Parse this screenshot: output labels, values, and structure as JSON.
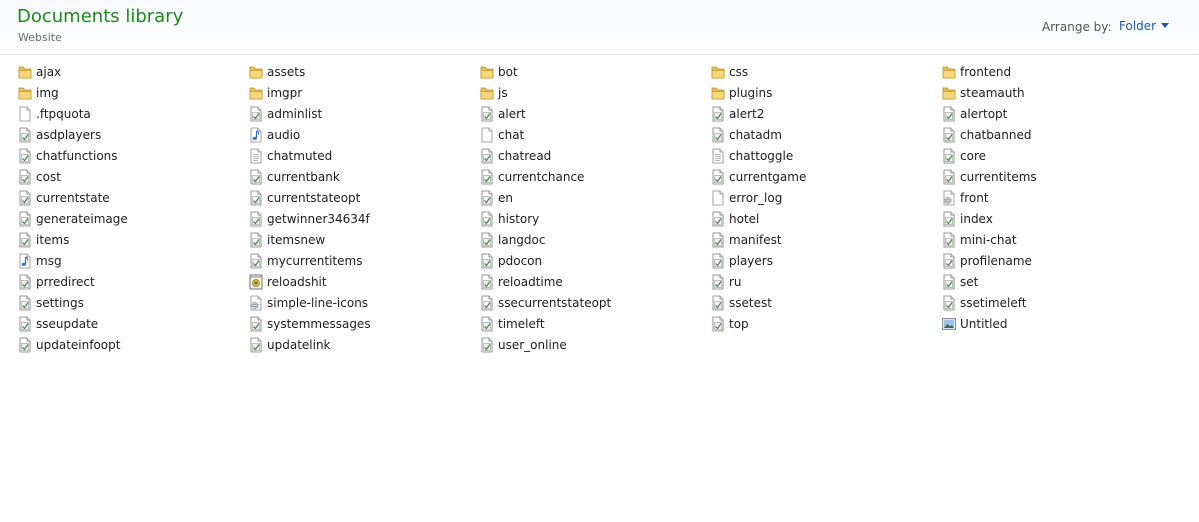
{
  "header": {
    "title": "Documents library",
    "subtitle": "Website",
    "arrange_label": "Arrange by:",
    "arrange_value": "Folder"
  },
  "files": [
    {
      "name": "ajax",
      "icon": "folder-icon"
    },
    {
      "name": "assets",
      "icon": "folder-icon"
    },
    {
      "name": "bot",
      "icon": "folder-icon"
    },
    {
      "name": "css",
      "icon": "folder-icon"
    },
    {
      "name": "frontend",
      "icon": "folder-icon"
    },
    {
      "name": "img",
      "icon": "folder-icon"
    },
    {
      "name": "imgpr",
      "icon": "folder-icon"
    },
    {
      "name": "js",
      "icon": "folder-icon"
    },
    {
      "name": "plugins",
      "icon": "folder-icon"
    },
    {
      "name": "steamauth",
      "icon": "folder-icon"
    },
    {
      "name": ".ftpquota",
      "icon": "blank-file-icon"
    },
    {
      "name": "adminlist",
      "icon": "script-file-icon"
    },
    {
      "name": "alert",
      "icon": "script-file-icon"
    },
    {
      "name": "alert2",
      "icon": "script-file-icon"
    },
    {
      "name": "alertopt",
      "icon": "script-file-icon"
    },
    {
      "name": "asdplayers",
      "icon": "script-file-icon"
    },
    {
      "name": "audio",
      "icon": "audio-file-icon"
    },
    {
      "name": "chat",
      "icon": "blank-file-icon"
    },
    {
      "name": "chatadm",
      "icon": "script-file-icon"
    },
    {
      "name": "chatbanned",
      "icon": "script-file-icon"
    },
    {
      "name": "chatfunctions",
      "icon": "script-file-icon"
    },
    {
      "name": "chatmuted",
      "icon": "text-file-icon"
    },
    {
      "name": "chatread",
      "icon": "script-file-icon"
    },
    {
      "name": "chattoggle",
      "icon": "text-file-icon"
    },
    {
      "name": "core",
      "icon": "script-file-icon"
    },
    {
      "name": "cost",
      "icon": "script-file-icon"
    },
    {
      "name": "currentbank",
      "icon": "script-file-icon"
    },
    {
      "name": "currentchance",
      "icon": "script-file-icon"
    },
    {
      "name": "currentgame",
      "icon": "script-file-icon"
    },
    {
      "name": "currentitems",
      "icon": "script-file-icon"
    },
    {
      "name": "currentstate",
      "icon": "script-file-icon"
    },
    {
      "name": "currentstateopt",
      "icon": "script-file-icon"
    },
    {
      "name": "en",
      "icon": "script-file-icon"
    },
    {
      "name": "error_log",
      "icon": "blank-file-icon"
    },
    {
      "name": "front",
      "icon": "gear-file-icon"
    },
    {
      "name": "generateimage",
      "icon": "script-file-icon"
    },
    {
      "name": "getwinner34634f",
      "icon": "script-file-icon"
    },
    {
      "name": "history",
      "icon": "script-file-icon"
    },
    {
      "name": "hotel",
      "icon": "script-file-icon"
    },
    {
      "name": "index",
      "icon": "script-file-icon"
    },
    {
      "name": "items",
      "icon": "script-file-icon"
    },
    {
      "name": "itemsnew",
      "icon": "script-file-icon"
    },
    {
      "name": "langdoc",
      "icon": "script-file-icon"
    },
    {
      "name": "manifest",
      "icon": "script-file-icon"
    },
    {
      "name": "mini-chat",
      "icon": "script-file-icon"
    },
    {
      "name": "msg",
      "icon": "audio-file-icon"
    },
    {
      "name": "mycurrentitems",
      "icon": "script-file-icon"
    },
    {
      "name": "pdocon",
      "icon": "script-file-icon"
    },
    {
      "name": "players",
      "icon": "script-file-icon"
    },
    {
      "name": "profilename",
      "icon": "script-file-icon"
    },
    {
      "name": "prredirect",
      "icon": "script-file-icon"
    },
    {
      "name": "reloadshit",
      "icon": "batch-file-icon"
    },
    {
      "name": "reloadtime",
      "icon": "script-file-icon"
    },
    {
      "name": "ru",
      "icon": "script-file-icon"
    },
    {
      "name": "set",
      "icon": "script-file-icon"
    },
    {
      "name": "settings",
      "icon": "script-file-icon"
    },
    {
      "name": "simple-line-icons",
      "icon": "gear-file-icon"
    },
    {
      "name": "ssecurrentstateopt",
      "icon": "script-file-icon"
    },
    {
      "name": "ssetest",
      "icon": "script-file-icon"
    },
    {
      "name": "ssetimeleft",
      "icon": "script-file-icon"
    },
    {
      "name": "sseupdate",
      "icon": "script-file-icon"
    },
    {
      "name": "systemmessages",
      "icon": "script-file-icon"
    },
    {
      "name": "timeleft",
      "icon": "script-file-icon"
    },
    {
      "name": "top",
      "icon": "script-file-icon"
    },
    {
      "name": "Untitled",
      "icon": "image-file-icon"
    },
    {
      "name": "updateinfoopt",
      "icon": "script-file-icon"
    },
    {
      "name": "updatelink",
      "icon": "script-file-icon"
    },
    {
      "name": "user_online",
      "icon": "script-file-icon"
    }
  ]
}
